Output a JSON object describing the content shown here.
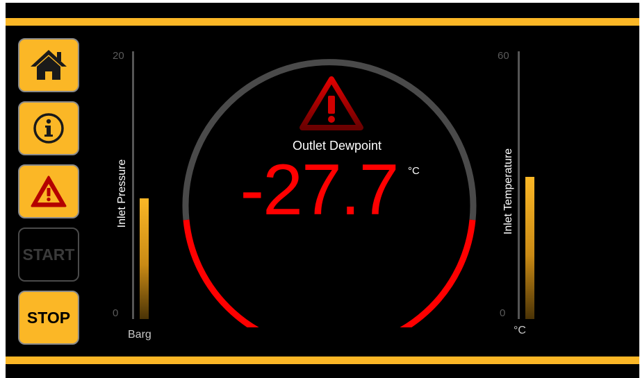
{
  "nav": {
    "home_icon": "home-icon",
    "info_icon": "info-icon",
    "alarm_icon": "warning-icon",
    "start_label": "START",
    "stop_label": "STOP"
  },
  "inlet_pressure": {
    "label": "Inlet Pressure",
    "max": "20",
    "min": "0",
    "unit": "Barg",
    "fill_fraction": 0.45
  },
  "inlet_temperature": {
    "label": "Inlet Temperature",
    "max": "60",
    "min": "0",
    "unit": "°C",
    "fill_fraction": 0.53
  },
  "dewpoint": {
    "title": "Outlet Dewpoint",
    "value": "-27.7",
    "unit": "°C",
    "alarm_icon": "warning-icon"
  },
  "colors": {
    "accent": "#fbb726",
    "alarm": "#ff0000",
    "background": "#000000",
    "track": "#555555"
  }
}
